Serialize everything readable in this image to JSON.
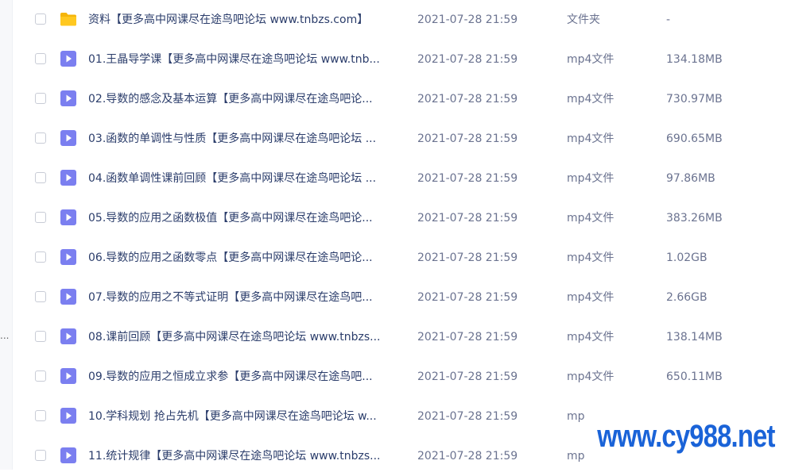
{
  "sidebar": {
    "ellipsis": "..."
  },
  "file_list": {
    "rows": [
      {
        "name": "资料【更多高中网课尽在途鸟吧论坛 www.tnbzs.com】",
        "date": "2021-07-28 21:59",
        "type": "文件夹",
        "size": "-",
        "icon": "folder-icon"
      },
      {
        "name": "01.王晶导学课【更多高中网课尽在途鸟吧论坛 www.tnb...",
        "date": "2021-07-28 21:59",
        "type": "mp4文件",
        "size": "134.18MB",
        "icon": "video-file-icon"
      },
      {
        "name": "02.导数的感念及基本运算【更多高中网课尽在途鸟吧论...",
        "date": "2021-07-28 21:59",
        "type": "mp4文件",
        "size": "730.97MB",
        "icon": "video-file-icon"
      },
      {
        "name": "03.函数的单调性与性质【更多高中网课尽在途鸟吧论坛 ...",
        "date": "2021-07-28 21:59",
        "type": "mp4文件",
        "size": "690.65MB",
        "icon": "video-file-icon"
      },
      {
        "name": "04.函数单调性课前回顾【更多高中网课尽在途鸟吧论坛 ...",
        "date": "2021-07-28 21:59",
        "type": "mp4文件",
        "size": "97.86MB",
        "icon": "video-file-icon"
      },
      {
        "name": "05.导数的应用之函数极值【更多高中网课尽在途鸟吧论...",
        "date": "2021-07-28 21:59",
        "type": "mp4文件",
        "size": "383.26MB",
        "icon": "video-file-icon"
      },
      {
        "name": "06.导数的应用之函数零点【更多高中网课尽在途鸟吧论...",
        "date": "2021-07-28 21:59",
        "type": "mp4文件",
        "size": "1.02GB",
        "icon": "video-file-icon"
      },
      {
        "name": "07.导数的应用之不等式证明【更多高中网课尽在途鸟吧...",
        "date": "2021-07-28 21:59",
        "type": "mp4文件",
        "size": "2.66GB",
        "icon": "video-file-icon"
      },
      {
        "name": "08.课前回顾【更多高中网课尽在途鸟吧论坛 www.tnbzs...",
        "date": "2021-07-28 21:59",
        "type": "mp4文件",
        "size": "138.14MB",
        "icon": "video-file-icon"
      },
      {
        "name": "09.导数的应用之恒成立求参【更多高中网课尽在途鸟吧...",
        "date": "2021-07-28 21:59",
        "type": "mp4文件",
        "size": "650.11MB",
        "icon": "video-file-icon"
      },
      {
        "name": "10.学科规划 抢占先机【更多高中网课尽在途鸟吧论坛 w...",
        "date": "2021-07-28 21:59",
        "type": "mp",
        "size": "",
        "icon": "video-file-icon"
      },
      {
        "name": "11.统计规律【更多高中网课尽在途鸟吧论坛 www.tnbzs...",
        "date": "2021-07-28 21:59",
        "type": "mp",
        "size": "",
        "icon": "video-file-icon"
      }
    ]
  },
  "watermark": {
    "text": "www.cy988.net"
  },
  "colors": {
    "folder": "#f5b50a",
    "video": "#7b7ff0",
    "name_text": "#2b3d6b",
    "meta_text": "#6b7390",
    "watermark": "#1a63d8"
  }
}
